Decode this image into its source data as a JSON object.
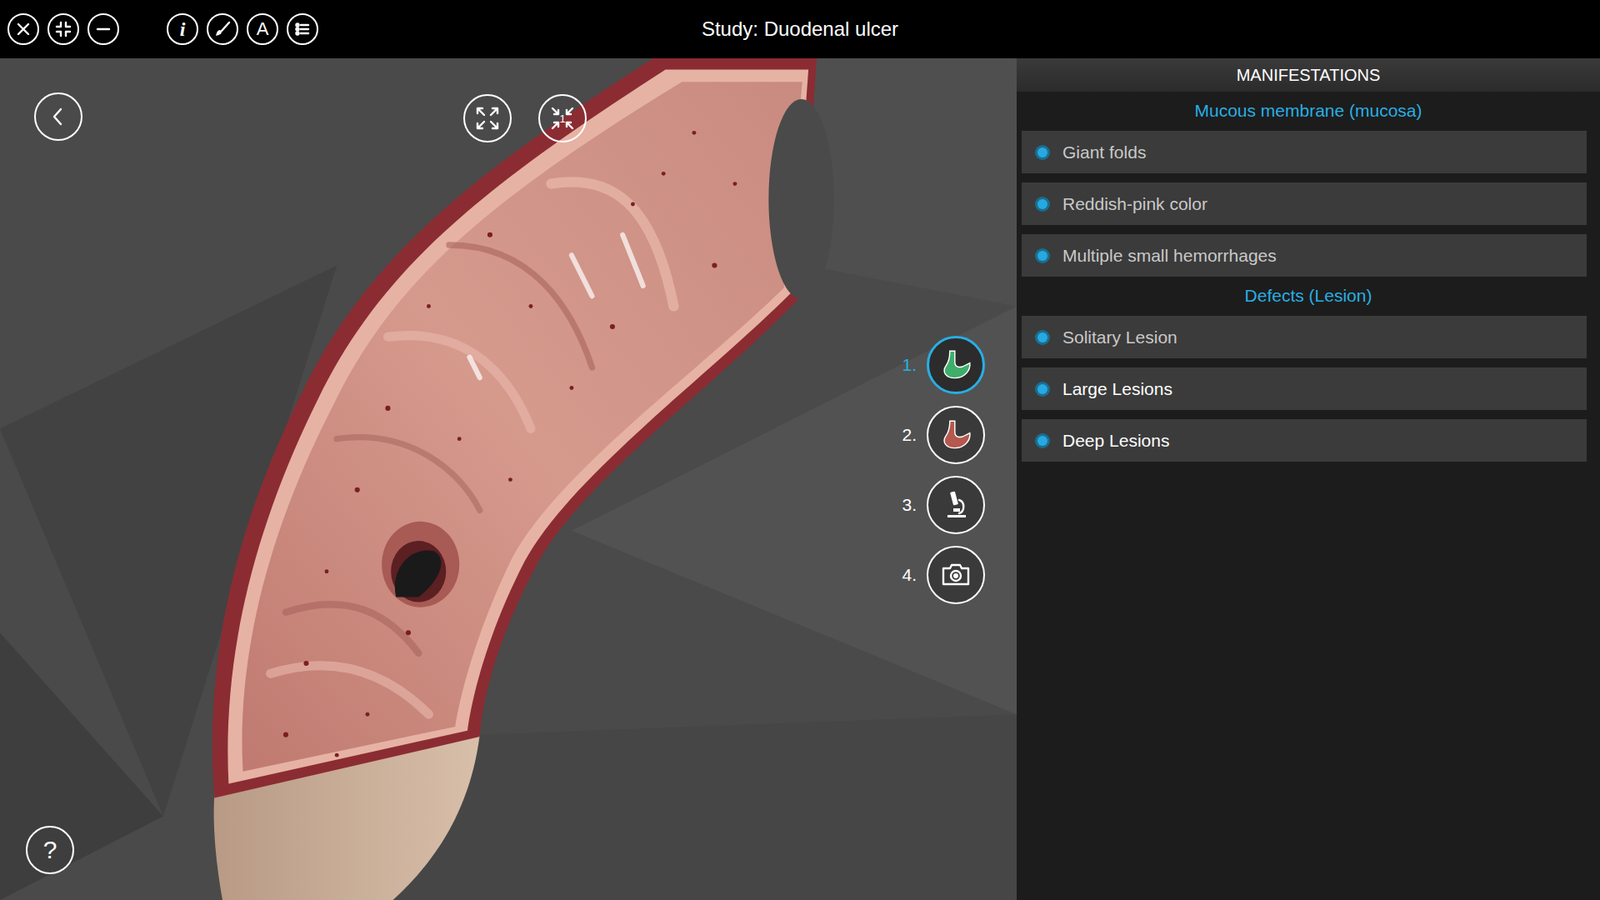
{
  "window": {
    "title": "Study: Duodenal ulcer"
  },
  "toolbar": [
    {
      "kind": "close"
    },
    {
      "kind": "collapse"
    },
    {
      "kind": "minimize"
    },
    {
      "kind": "info",
      "glyph": "i"
    },
    {
      "kind": "brush"
    },
    {
      "kind": "text",
      "glyph": "A"
    },
    {
      "kind": "list"
    }
  ],
  "view_buttons": [
    {
      "kind": "expand"
    },
    {
      "kind": "expand-numbered",
      "badge": "1"
    }
  ],
  "steps": [
    {
      "number": "1.",
      "kind": "stomach",
      "selected": true,
      "color": "#3fae6a"
    },
    {
      "number": "2.",
      "kind": "stomach",
      "selected": false,
      "color": "#b5584e"
    },
    {
      "number": "3.",
      "kind": "microscope",
      "selected": false
    },
    {
      "number": "4.",
      "kind": "camera",
      "selected": false
    }
  ],
  "help": "?",
  "panel": {
    "title": "MANIFESTATIONS",
    "sections": [
      {
        "title": "Mucous membrane (mucosa)",
        "items": [
          {
            "label": "Giant folds",
            "highlighted": false
          },
          {
            "label": "Reddish-pink color",
            "highlighted": false
          },
          {
            "label": "Multiple small hemorrhages",
            "highlighted": false
          }
        ]
      },
      {
        "title": "Defects (Lesion)",
        "items": [
          {
            "label": "Solitary Lesion",
            "highlighted": false
          },
          {
            "label": "Large Lesions",
            "highlighted": true
          },
          {
            "label": "Deep Lesions",
            "highlighted": true
          }
        ]
      }
    ]
  }
}
